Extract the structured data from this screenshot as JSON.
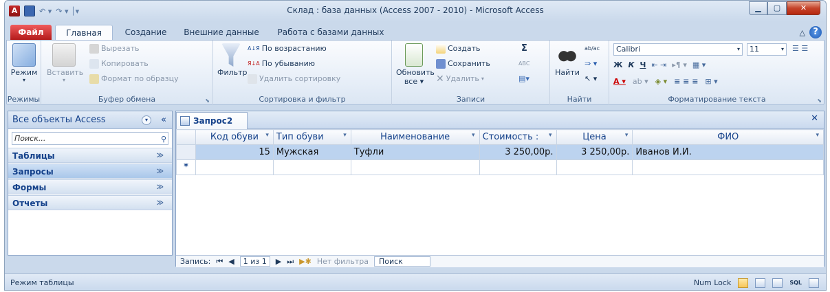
{
  "window": {
    "title": "Склад : база данных (Access 2007 - 2010)  -  Microsoft Access",
    "app_letter": "A",
    "qat_undo": "↶ ▾",
    "qat_redo": "↷ ▾ │▾",
    "min": "▁",
    "max": "▢",
    "close": "✕"
  },
  "tabs": [
    "Файл",
    "Главная",
    "Создание",
    "Внешние данные",
    "Работа с базами данных"
  ],
  "help": {
    "caret": "△",
    "q": "?"
  },
  "ribbon": {
    "modes": {
      "view": "Режим",
      "view_caret": "▾",
      "label": "Режимы"
    },
    "clipboard": {
      "paste": "Вставить",
      "paste_caret": "▾",
      "cut": "Вырезать",
      "copy": "Копировать",
      "format": "Формат по образцу",
      "label": "Буфер обмена",
      "launcher": "⬊"
    },
    "sort": {
      "filter": "Фильтр",
      "asc": "По возрастанию",
      "desc": "По убыванию",
      "remove": "Удалить сортировку",
      "label": "Сортировка и фильтр",
      "asc_glyph": "А↓Я",
      "desc_glyph": "Я↓А"
    },
    "records": {
      "refresh": "Обновить",
      "refresh2": "все ▾",
      "new": "Создать",
      "save": "Сохранить",
      "delete": "Удалить",
      "delete_caret": "▾",
      "totals": "Σ",
      "spelling": "ABC",
      "more": "▤▾",
      "label": "Записи"
    },
    "find": {
      "find": "Найти",
      "replace": "ab/ac",
      "goto": "⇒ ▾",
      "select": "↖ ▾",
      "label": "Найти"
    },
    "text": {
      "font": "Calibri",
      "size": "11",
      "bold": "Ж",
      "italic": "К",
      "underline": "Ч",
      "label": "Форматирование текста",
      "launcher": "⬊",
      "caret": "▾",
      "indent": "⇤ ⇥",
      "para": "▸¶ ▾",
      "list": "☰ ☰",
      "grid": "▦ ▾",
      "color": "A ▾",
      "hl": "ab ▾",
      "fill": "◈ ▾",
      "align": "≡ ≡ ≡",
      "borders": "⊞ ▾"
    }
  },
  "nav": {
    "title": "Все объекты Access",
    "caret": "▾",
    "collapse": "«",
    "search_placeholder": "Поиск...",
    "search_glyph": "⚲",
    "chevron": "≫",
    "sections": [
      "Таблицы",
      "Запросы",
      "Формы",
      "Отчеты"
    ]
  },
  "doc": {
    "tab": "Запрос2",
    "close": "✕",
    "columns": [
      "Код обуви",
      "Тип обуви",
      "Наименование",
      "Стоимость :",
      "Цена",
      "ФИО"
    ],
    "rows": [
      [
        "15",
        "Мужская",
        "Туфли",
        "3 250,00р.",
        "3 250,00р.",
        "Иванов И.И."
      ]
    ],
    "new_row_marker": "*",
    "dd": "▾"
  },
  "recbar": {
    "label": "Запись:",
    "first": "⏮",
    "prev": "◀",
    "pos": "1 из 1",
    "next": "▶",
    "last": "⏭",
    "new": "▶✱",
    "nofilter": "Нет фильтра",
    "search": "Поиск"
  },
  "status": {
    "left": "Режим таблицы",
    "numlock": "Num Lock",
    "sql": "SQL"
  }
}
